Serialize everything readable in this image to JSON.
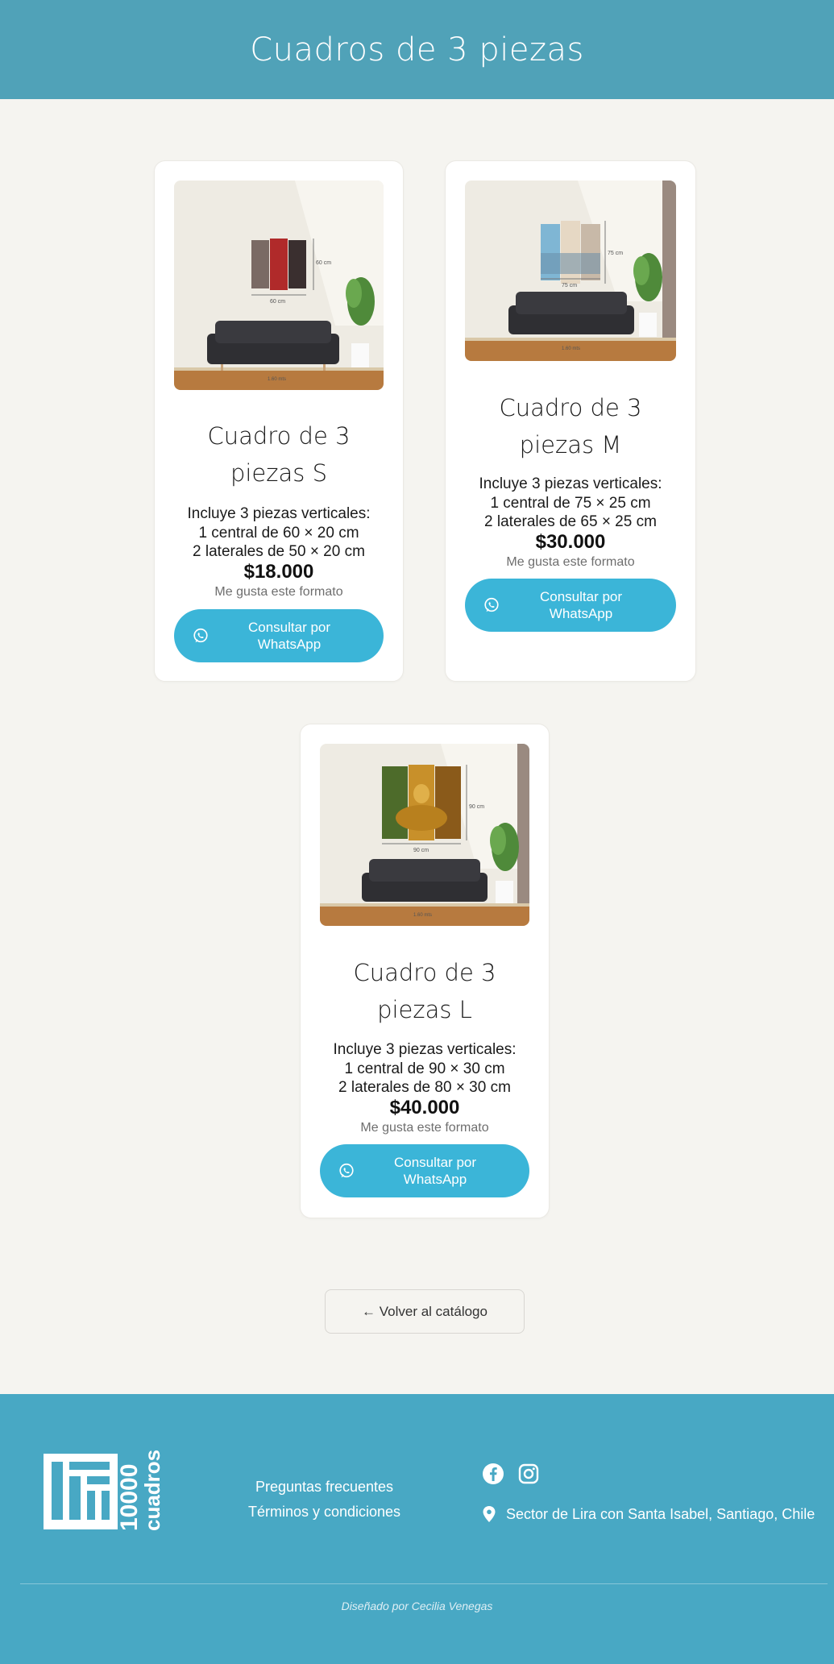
{
  "page": {
    "title": "Cuadros de 3 piezas"
  },
  "products": [
    {
      "name": "Cuadro de 3 piezas S",
      "name_line1": "Cuadro de 3",
      "name_line2": "piezas S",
      "desc_line1": "Incluye 3 piezas verticales:",
      "desc_line2": "1 central de 60 × 20 cm",
      "desc_line3": "2 laterales de 50 × 20 cm",
      "price": "$18.000",
      "like_label": "Me gusta este formato",
      "cta_line1": "Consultar por",
      "cta_line2": "WhatsApp",
      "image": {
        "width_label": "60 cm",
        "height_label": "60 cm",
        "sofa_label": "1.60 mts",
        "art_palette": [
          "#7a6a64",
          "#b02a2a",
          "#3a2f2f"
        ]
      }
    },
    {
      "name": "Cuadro de 3 piezas M",
      "name_line1": "Cuadro de 3",
      "name_line2": "piezas M",
      "desc_line1": "Incluye 3 piezas verticales:",
      "desc_line2": "1 central de 75 × 25 cm",
      "desc_line3": "2 laterales de 65 × 25 cm",
      "price": "$30.000",
      "like_label": "Me gusta este formato",
      "cta_line1": "Consultar por",
      "cta_line2": "WhatsApp",
      "image": {
        "width_label": "75 cm",
        "height_label": "75 cm",
        "sofa_label": "1.60 mts",
        "art_palette": [
          "#7fb6d4",
          "#e6d8c4",
          "#c8b9a8"
        ]
      }
    },
    {
      "name": "Cuadro de 3 piezas L",
      "name_line1": "Cuadro de 3",
      "name_line2": "piezas L",
      "desc_line1": "Incluye 3 piezas verticales:",
      "desc_line2": "1 central de 90 × 30 cm",
      "desc_line3": "2 laterales de 80 × 30 cm",
      "price": "$40.000",
      "like_label": "Me gusta este formato",
      "cta_line1": "Consultar por",
      "cta_line2": "WhatsApp",
      "image": {
        "width_label": "90 cm",
        "height_label": "90 cm",
        "sofa_label": "1.60 mts",
        "art_palette": [
          "#4d6b2a",
          "#c8902a",
          "#8a5a1a"
        ]
      }
    }
  ],
  "back_button": {
    "label": "← Volver al catálogo"
  },
  "footer": {
    "logo": {
      "text": "10000 cuadros"
    },
    "links": [
      "Preguntas frecuentes",
      "Términos y condiciones"
    ],
    "social_icons": [
      "facebook-icon",
      "instagram-icon"
    ],
    "address": "Sector de Lira con Santa Isabel, Santiago, Chile",
    "credit": "Diseñado por Cecilia Venegas"
  },
  "colors": {
    "header": "#50a2b8",
    "footer": "#48a8c4",
    "background": "#f5f4f0",
    "cta": "#3bb5d8"
  }
}
